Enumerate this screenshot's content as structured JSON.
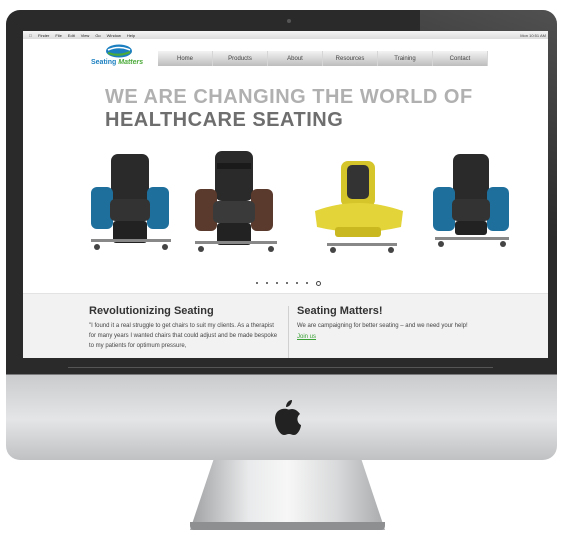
{
  "menubar": {
    "items": [
      "Finder",
      "File",
      "Edit",
      "View",
      "Go",
      "Window",
      "Help"
    ],
    "right": "Mon 10:51 AM"
  },
  "site": {
    "logo_text_1": "Seating",
    "logo_text_2": "Matters",
    "nav": [
      "Home",
      "Products",
      "About",
      "Resources",
      "Training",
      "Contact"
    ],
    "headline_line1": "WE ARE CHANGING THE WORLD OF",
    "headline_line2": "HEALTHCARE SEATING",
    "slide_count": 7,
    "active_slide": 7,
    "left_title": "Revolutionizing Seating",
    "left_body": "\"I found it a real struggle to get chairs to suit my clients. As a therapist for many years I wanted chairs that could adjust and be made bespoke to my patients for optimum pressure,",
    "right_title": "Seating Matters!",
    "right_body": "We are campaigning for better seating – and we need your help!",
    "right_link": "Join us"
  },
  "colors": {
    "brand_blue": "#1b7fc0",
    "brand_green": "#4caa3a",
    "chair_blue": "#1f6f9c",
    "chair_brown": "#5a3a2c",
    "chair_yellow": "#d5c52a",
    "chair_black": "#2a2a2a"
  }
}
